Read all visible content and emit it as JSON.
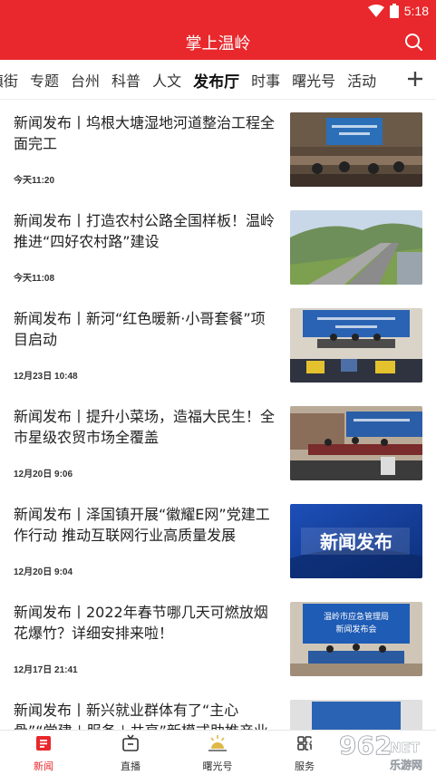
{
  "status": {
    "time": "5:18"
  },
  "app": {
    "title": "掌上温岭"
  },
  "tabs": [
    "镇街",
    "专题",
    "台州",
    "科普",
    "人文",
    "发布厅",
    "时事",
    "曙光号",
    "活动"
  ],
  "active_tab": "发布厅",
  "news": [
    {
      "title": "新闻发布丨坞根大塘湿地河道整治工程全面完工",
      "time": "今天11:20"
    },
    {
      "title": "新闻发布丨打造农村公路全国样板！温岭推进“四好农村路”建设",
      "time": "今天11:08"
    },
    {
      "title": "新闻发布丨新河“红色暖新·小哥套餐”项目启动",
      "time": "12月23日 10:48"
    },
    {
      "title": "新闻发布丨提升小菜场，造福大民生！全市星级农贸市场全覆盖",
      "time": "12月20日 9:06"
    },
    {
      "title": "新闻发布丨泽国镇开展“徽耀E网”党建工作行动 推动互联网行业高质量发展",
      "time": "12月20日 9:04",
      "thumb_text": "新闻发布"
    },
    {
      "title": "新闻发布丨2022年春节哪几天可燃放烟花爆竹？详细安排来啦！",
      "time": "12月17日 21:41",
      "thumb_text": "温岭市应急管理局\n新闻发布会"
    },
    {
      "title": "新闻发布丨新兴就业群体有了“主心骨”“党建＋服务＋共享”新模式助推产业升级",
      "time": ""
    }
  ],
  "bottom_nav": [
    {
      "label": "新闻",
      "icon": "news-icon",
      "active": true
    },
    {
      "label": "直播",
      "icon": "tv-icon",
      "active": false
    },
    {
      "label": "曙光号",
      "icon": "sunrise-icon",
      "active": false
    },
    {
      "label": "服务",
      "icon": "service-icon",
      "active": false
    }
  ],
  "watermark": {
    "text": "962",
    "suffix": "NET",
    "sub": "乐游网"
  },
  "colors": {
    "brand": "#e8282c",
    "active_nav": "#e8282c"
  }
}
